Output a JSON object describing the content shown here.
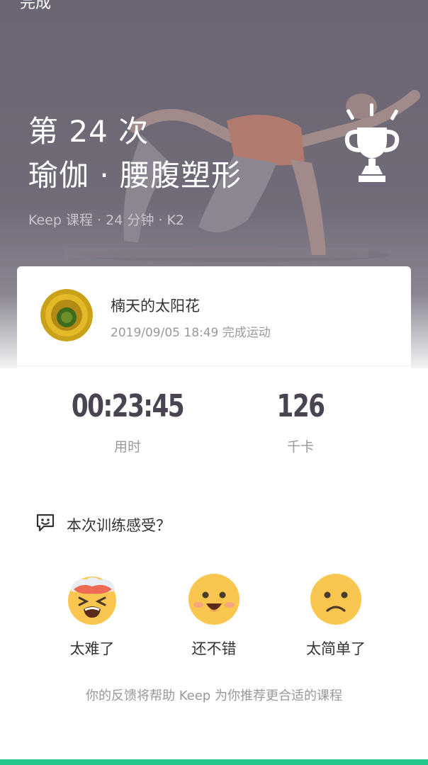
{
  "header": {
    "top_label": "完成",
    "count_title": "第 24 次",
    "course_title": "瑜伽 · 腰腹塑形",
    "meta": "Keep 课程 · 24 分钟 · K2"
  },
  "icons": {
    "trophy": "trophy-icon",
    "feedback": "feedback-chat-icon",
    "hard": "emoji-too-hard",
    "ok": "emoji-not-bad",
    "easy": "emoji-too-easy"
  },
  "user": {
    "name": "楠天的太阳花",
    "completed_at": "2019/09/05 18:49 完成运动"
  },
  "stats": {
    "duration": {
      "value": "00:23:45",
      "label": "用时"
    },
    "calories": {
      "value": "126",
      "label": "千卡"
    }
  },
  "feedback": {
    "title": "本次训练感受？",
    "options": [
      {
        "label": "太难了"
      },
      {
        "label": "还不错"
      },
      {
        "label": "太简单了"
      }
    ],
    "note": "你的反馈将帮助 Keep 为你推荐更合适的课程"
  },
  "colors": {
    "accent": "#24c789",
    "hero_overlay": "#6c6674",
    "emoji_yellow": "#f9c74f",
    "stat_text": "#4a4452"
  }
}
